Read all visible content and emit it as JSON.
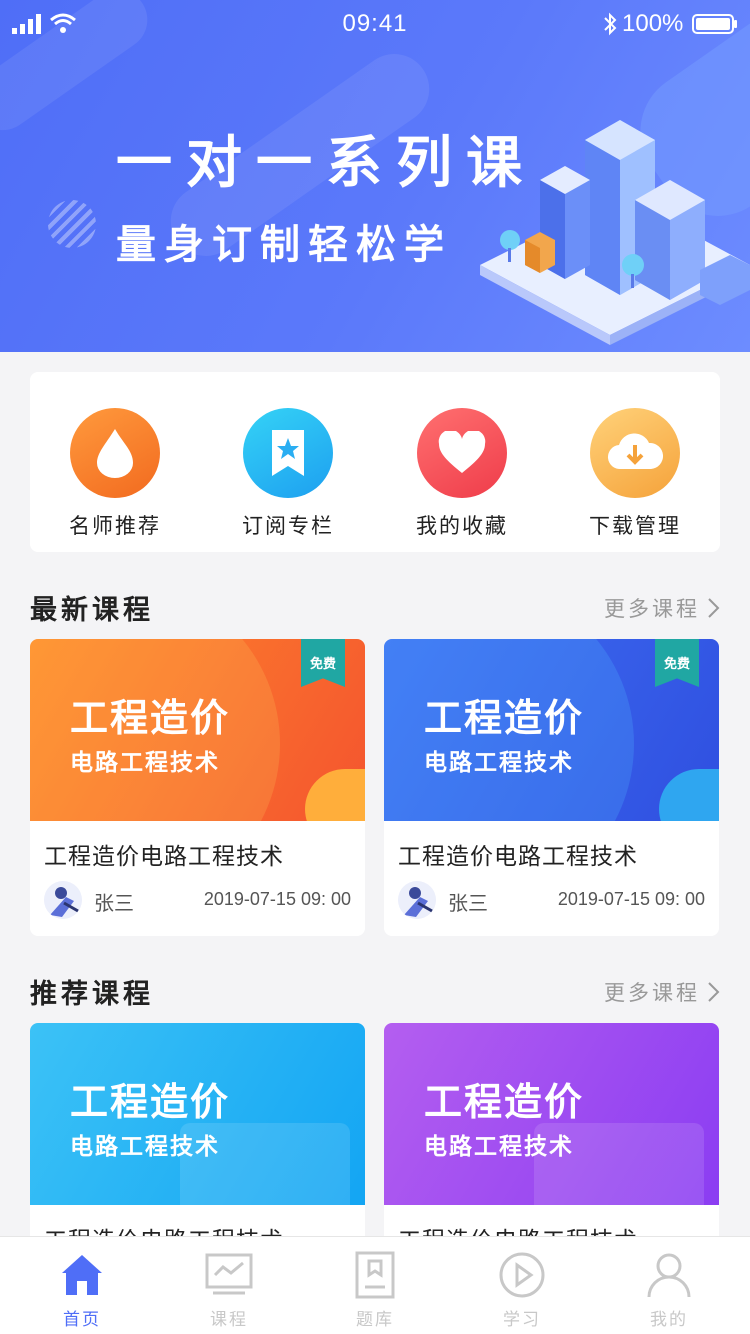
{
  "status_bar": {
    "time": "09:41",
    "battery": "100%"
  },
  "banner": {
    "title": "一对一系列课",
    "subtitle": "量身订制轻松学"
  },
  "quick_menu": [
    {
      "label": "名师推荐",
      "icon": "flame-icon",
      "color": "#f47b2a"
    },
    {
      "label": "订阅专栏",
      "icon": "bookmark-star-icon",
      "color": "#2eb5f0"
    },
    {
      "label": "我的收藏",
      "icon": "heart-icon",
      "color": "#f5525a"
    },
    {
      "label": "下载管理",
      "icon": "cloud-download-icon",
      "color": "#f5b043"
    }
  ],
  "latest": {
    "title": "最新课程",
    "more": "更多课程",
    "cards": [
      {
        "cover_title": "工程造价",
        "cover_sub": "电路工程技术",
        "badge": "免费",
        "name": "工程造价电路工程技术",
        "author": "张三",
        "date": "2019-07-15 09: 00"
      },
      {
        "cover_title": "工程造价",
        "cover_sub": "电路工程技术",
        "badge": "免费",
        "name": "工程造价电路工程技术",
        "author": "张三",
        "date": "2019-07-15 09: 00"
      }
    ]
  },
  "recommended": {
    "title": "推荐课程",
    "more": "更多课程",
    "cards": [
      {
        "cover_title": "工程造价",
        "cover_sub": "电路工程技术",
        "name": "工程造价电路工程技术"
      },
      {
        "cover_title": "工程造价",
        "cover_sub": "电路工程技术",
        "name": "工程造价电路工程技术"
      }
    ]
  },
  "tabs": [
    {
      "label": "首页",
      "icon": "home-icon",
      "active": true
    },
    {
      "label": "课程",
      "icon": "course-icon",
      "active": false
    },
    {
      "label": "题库",
      "icon": "question-bank-icon",
      "active": false
    },
    {
      "label": "学习",
      "icon": "play-icon",
      "active": false
    },
    {
      "label": "我的",
      "icon": "user-icon",
      "active": false
    }
  ]
}
